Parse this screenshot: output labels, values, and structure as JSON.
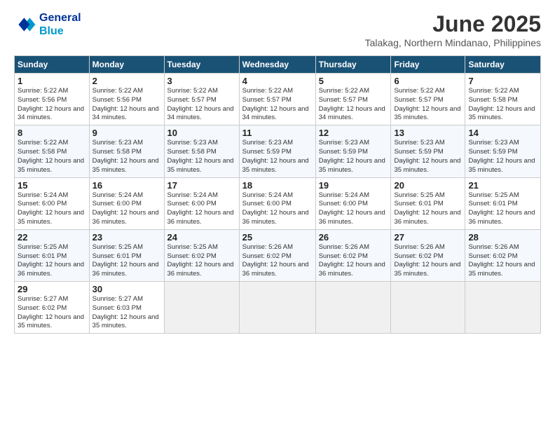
{
  "logo": {
    "line1": "General",
    "line2": "Blue"
  },
  "title": "June 2025",
  "subtitle": "Talakag, Northern Mindanao, Philippines",
  "header": {
    "days": [
      "Sunday",
      "Monday",
      "Tuesday",
      "Wednesday",
      "Thursday",
      "Friday",
      "Saturday"
    ]
  },
  "weeks": [
    [
      {
        "day": "1",
        "sunrise": "5:22 AM",
        "sunset": "5:56 PM",
        "daylight": "12 hours and 34 minutes."
      },
      {
        "day": "2",
        "sunrise": "5:22 AM",
        "sunset": "5:56 PM",
        "daylight": "12 hours and 34 minutes."
      },
      {
        "day": "3",
        "sunrise": "5:22 AM",
        "sunset": "5:57 PM",
        "daylight": "12 hours and 34 minutes."
      },
      {
        "day": "4",
        "sunrise": "5:22 AM",
        "sunset": "5:57 PM",
        "daylight": "12 hours and 34 minutes."
      },
      {
        "day": "5",
        "sunrise": "5:22 AM",
        "sunset": "5:57 PM",
        "daylight": "12 hours and 34 minutes."
      },
      {
        "day": "6",
        "sunrise": "5:22 AM",
        "sunset": "5:57 PM",
        "daylight": "12 hours and 35 minutes."
      },
      {
        "day": "7",
        "sunrise": "5:22 AM",
        "sunset": "5:58 PM",
        "daylight": "12 hours and 35 minutes."
      }
    ],
    [
      {
        "day": "8",
        "sunrise": "5:22 AM",
        "sunset": "5:58 PM",
        "daylight": "12 hours and 35 minutes."
      },
      {
        "day": "9",
        "sunrise": "5:23 AM",
        "sunset": "5:58 PM",
        "daylight": "12 hours and 35 minutes."
      },
      {
        "day": "10",
        "sunrise": "5:23 AM",
        "sunset": "5:58 PM",
        "daylight": "12 hours and 35 minutes."
      },
      {
        "day": "11",
        "sunrise": "5:23 AM",
        "sunset": "5:59 PM",
        "daylight": "12 hours and 35 minutes."
      },
      {
        "day": "12",
        "sunrise": "5:23 AM",
        "sunset": "5:59 PM",
        "daylight": "12 hours and 35 minutes."
      },
      {
        "day": "13",
        "sunrise": "5:23 AM",
        "sunset": "5:59 PM",
        "daylight": "12 hours and 35 minutes."
      },
      {
        "day": "14",
        "sunrise": "5:23 AM",
        "sunset": "5:59 PM",
        "daylight": "12 hours and 35 minutes."
      }
    ],
    [
      {
        "day": "15",
        "sunrise": "5:24 AM",
        "sunset": "6:00 PM",
        "daylight": "12 hours and 35 minutes."
      },
      {
        "day": "16",
        "sunrise": "5:24 AM",
        "sunset": "6:00 PM",
        "daylight": "12 hours and 36 minutes."
      },
      {
        "day": "17",
        "sunrise": "5:24 AM",
        "sunset": "6:00 PM",
        "daylight": "12 hours and 36 minutes."
      },
      {
        "day": "18",
        "sunrise": "5:24 AM",
        "sunset": "6:00 PM",
        "daylight": "12 hours and 36 minutes."
      },
      {
        "day": "19",
        "sunrise": "5:24 AM",
        "sunset": "6:00 PM",
        "daylight": "12 hours and 36 minutes."
      },
      {
        "day": "20",
        "sunrise": "5:25 AM",
        "sunset": "6:01 PM",
        "daylight": "12 hours and 36 minutes."
      },
      {
        "day": "21",
        "sunrise": "5:25 AM",
        "sunset": "6:01 PM",
        "daylight": "12 hours and 36 minutes."
      }
    ],
    [
      {
        "day": "22",
        "sunrise": "5:25 AM",
        "sunset": "6:01 PM",
        "daylight": "12 hours and 36 minutes."
      },
      {
        "day": "23",
        "sunrise": "5:25 AM",
        "sunset": "6:01 PM",
        "daylight": "12 hours and 36 minutes."
      },
      {
        "day": "24",
        "sunrise": "5:25 AM",
        "sunset": "6:02 PM",
        "daylight": "12 hours and 36 minutes."
      },
      {
        "day": "25",
        "sunrise": "5:26 AM",
        "sunset": "6:02 PM",
        "daylight": "12 hours and 36 minutes."
      },
      {
        "day": "26",
        "sunrise": "5:26 AM",
        "sunset": "6:02 PM",
        "daylight": "12 hours and 36 minutes."
      },
      {
        "day": "27",
        "sunrise": "5:26 AM",
        "sunset": "6:02 PM",
        "daylight": "12 hours and 35 minutes."
      },
      {
        "day": "28",
        "sunrise": "5:26 AM",
        "sunset": "6:02 PM",
        "daylight": "12 hours and 35 minutes."
      }
    ],
    [
      {
        "day": "29",
        "sunrise": "5:27 AM",
        "sunset": "6:02 PM",
        "daylight": "12 hours and 35 minutes."
      },
      {
        "day": "30",
        "sunrise": "5:27 AM",
        "sunset": "6:03 PM",
        "daylight": "12 hours and 35 minutes."
      },
      null,
      null,
      null,
      null,
      null
    ]
  ]
}
